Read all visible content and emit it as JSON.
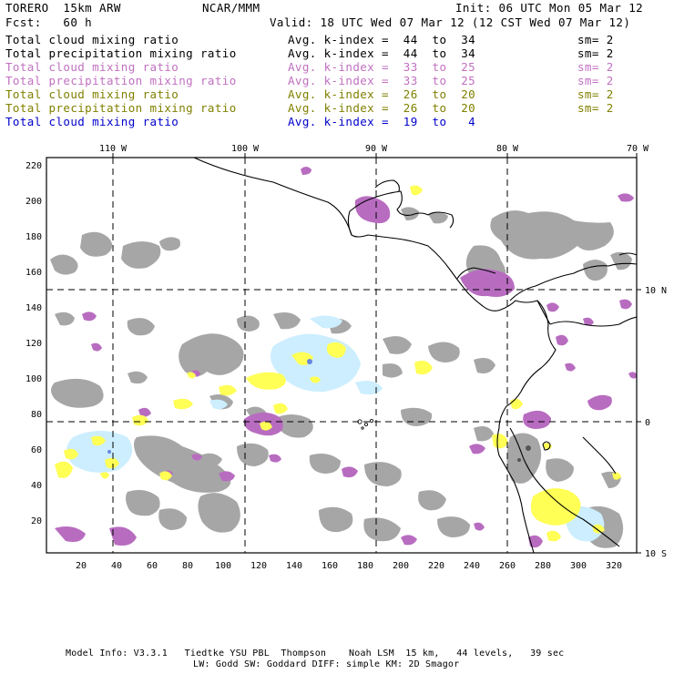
{
  "header": {
    "model": "TORERO  15km ARW",
    "fcst": "Fcst:   60 h",
    "center": "NCAR/MMM",
    "init": "Init: 06 UTC Mon 05 Mar 12",
    "valid": "Valid: 18 UTC Wed 07 Mar 12 (12 CST Wed 07 Mar 12)"
  },
  "legend": [
    {
      "field": "Total cloud mixing ratio",
      "index": "Avg. k-index =  44  to  34",
      "sm": "sm= 2",
      "color": "#000000"
    },
    {
      "field": "Total precipitation mixing ratio",
      "index": "Avg. k-index =  44  to  34",
      "sm": "sm= 2",
      "color": "#000000"
    },
    {
      "field": "Total cloud mixing ratio",
      "index": "Avg. k-index =  33  to  25",
      "sm": "sm= 2",
      "color": "#c070c0"
    },
    {
      "field": "Total precipitation mixing ratio",
      "index": "Avg. k-index =  33  to  25",
      "sm": "sm= 2",
      "color": "#c070c0"
    },
    {
      "field": "Total cloud mixing ratio",
      "index": "Avg. k-index =  26  to  20",
      "sm": "sm= 2",
      "color": "#808000"
    },
    {
      "field": "Total precipitation mixing ratio",
      "index": "Avg. k-index =  26  to  20",
      "sm": "sm= 2",
      "color": "#808000"
    },
    {
      "field": "Total cloud mixing ratio",
      "index": "Avg. k-index =  19  to   4",
      "sm": "",
      "color": "#0000cc"
    }
  ],
  "axes": {
    "top_lon": [
      "110 W",
      "100 W",
      "90 W",
      "80 W",
      "70 W"
    ],
    "right_lat": [
      "10 N",
      "0",
      "10 S"
    ],
    "left_y": [
      "220",
      "200",
      "180",
      "160",
      "140",
      "120",
      "100",
      "80",
      "60",
      "40",
      "20"
    ],
    "bottom_x": [
      "20",
      "40",
      "60",
      "80",
      "100",
      "120",
      "140",
      "160",
      "180",
      "200",
      "220",
      "240",
      "260",
      "280",
      "300",
      "320"
    ]
  },
  "footer": {
    "line1": "Model Info: V3.3.1   Tiedtke YSU PBL  Thompson    Noah LSM  15 km,   44 levels,   39 sec",
    "line2": "LW: Godd SW: Goddard DIFF: simple KM: 2D Smagor"
  },
  "colors": {
    "gray": "#a6a6a6",
    "purple": "#b86cc0",
    "yellow": "#ffff55",
    "lightblue": "#cceeff"
  }
}
